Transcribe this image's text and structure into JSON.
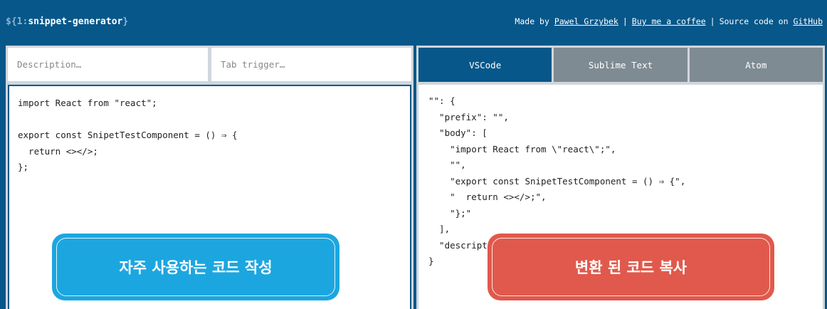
{
  "header": {
    "logo_prefix": "${1:",
    "logo_name": "snippet-generator",
    "logo_suffix": "}",
    "made_by": "Made by",
    "author": "Pawel Grzybek",
    "sep1": "|",
    "coffee": "Buy me a coffee",
    "sep2": "|",
    "source": "Source code on",
    "github": "GitHub"
  },
  "inputs": {
    "description_placeholder": "Description…",
    "tab_trigger_placeholder": "Tab trigger…"
  },
  "editor": {
    "code": "import React from \"react\";\n\nexport const SnipetTestComponent = () ⇒ {\n  return <></>;\n};"
  },
  "tabs": [
    {
      "label": "VSCode",
      "active": true
    },
    {
      "label": "Sublime Text",
      "active": false
    },
    {
      "label": "Atom",
      "active": false
    }
  ],
  "output": {
    "code": "\"\": {\n  \"prefix\": \"\",\n  \"body\": [\n    \"import React from \\\"react\\\";\",\n    \"\",\n    \"export const SnipetTestComponent = () ⇒ {\",\n    \"  return <></>;\",\n    \"};\"\n  ],\n  \"description\": \"\"\n}"
  },
  "callouts": {
    "left": "자주 사용하는 코드 작성",
    "right": "변환 된 코드 복사"
  },
  "colors": {
    "background": "#07578a",
    "callout_left": "#1ca6e0",
    "callout_right": "#e0594c",
    "tab_inactive": "#7f8b93"
  }
}
